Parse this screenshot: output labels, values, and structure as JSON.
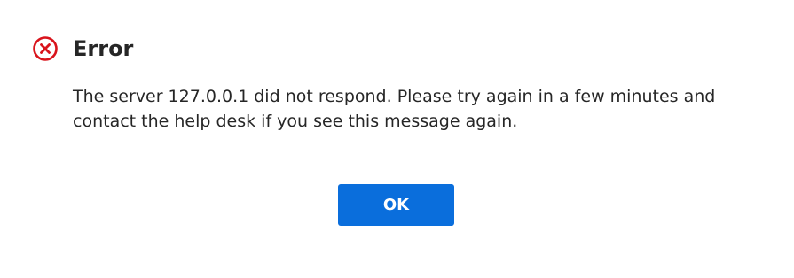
{
  "dialog": {
    "title": "Error",
    "icon": "error-circle-x-icon",
    "message": "The server 127.0.0.1 did not respond. Please try again in a few minutes and contact the help desk if you see this message again.",
    "ok_label": "OK"
  },
  "colors": {
    "error_red": "#d9141c",
    "button_blue": "#0a6edc",
    "text": "#262626",
    "background": "#ffffff"
  }
}
